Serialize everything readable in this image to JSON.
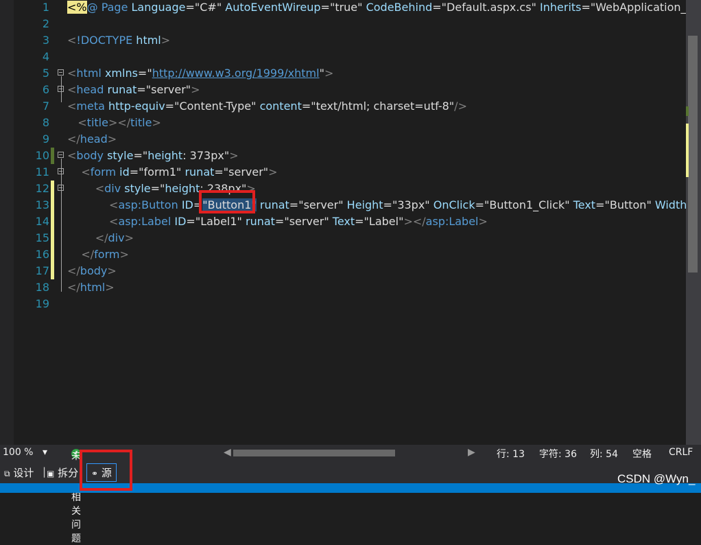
{
  "editor": {
    "line_numbers": [
      "1",
      "2",
      "3",
      "4",
      "5",
      "6",
      "7",
      "8",
      "9",
      "10",
      "11",
      "12",
      "13",
      "14",
      "15",
      "16",
      "17",
      "18",
      "19"
    ],
    "lines": [
      {
        "no": "1",
        "tokens": [
          {
            "c": "dir",
            "t": "<%"
          },
          {
            "c": "k",
            "t": "@ Page "
          },
          {
            "c": "a",
            "t": "Language"
          },
          {
            "c": "p",
            "t": "="
          },
          {
            "c": "p",
            "t": "\"C#\" "
          },
          {
            "c": "a",
            "t": "AutoEventWireup"
          },
          {
            "c": "p",
            "t": "="
          },
          {
            "c": "p",
            "t": "\"true\" "
          },
          {
            "c": "a",
            "t": "CodeBehind"
          },
          {
            "c": "p",
            "t": "="
          },
          {
            "c": "p",
            "t": "\"Default.aspx.cs\" "
          },
          {
            "c": "a",
            "t": "Inherits"
          },
          {
            "c": "p",
            "t": "="
          },
          {
            "c": "p",
            "t": "\"WebApplication_te"
          }
        ]
      },
      {
        "no": "2",
        "tokens": []
      },
      {
        "no": "3",
        "tokens": [
          {
            "c": "t",
            "t": "<"
          },
          {
            "c": "e",
            "t": "!DOCTYPE "
          },
          {
            "c": "a",
            "t": "html"
          },
          {
            "c": "t",
            "t": ">"
          }
        ]
      },
      {
        "no": "4",
        "tokens": []
      },
      {
        "no": "5",
        "tokens": [
          {
            "c": "t",
            "t": "<"
          },
          {
            "c": "e",
            "t": "html "
          },
          {
            "c": "a",
            "t": "xmlns"
          },
          {
            "c": "p",
            "t": "=\""
          },
          {
            "c": "l",
            "t": "http://www.w3.org/1999/xhtml"
          },
          {
            "c": "p",
            "t": "\""
          },
          {
            "c": "t",
            "t": ">"
          }
        ]
      },
      {
        "no": "6",
        "tokens": [
          {
            "c": "t",
            "t": "<"
          },
          {
            "c": "e",
            "t": "head "
          },
          {
            "c": "a",
            "t": "runat"
          },
          {
            "c": "p",
            "t": "=\"server\""
          },
          {
            "c": "t",
            "t": ">"
          }
        ]
      },
      {
        "no": "7",
        "tokens": [
          {
            "c": "t",
            "t": "<"
          },
          {
            "c": "e",
            "t": "meta "
          },
          {
            "c": "a",
            "t": "http-equiv"
          },
          {
            "c": "p",
            "t": "=\"Content-Type\" "
          },
          {
            "c": "a",
            "t": "content"
          },
          {
            "c": "p",
            "t": "=\"text/html; charset=utf-8\""
          },
          {
            "c": "t",
            "t": "/>"
          }
        ]
      },
      {
        "no": "8",
        "tokens": [
          {
            "c": "p",
            "t": "   "
          },
          {
            "c": "t",
            "t": "<"
          },
          {
            "c": "e",
            "t": "title"
          },
          {
            "c": "t",
            "t": "></"
          },
          {
            "c": "e",
            "t": "title"
          },
          {
            "c": "t",
            "t": ">"
          }
        ]
      },
      {
        "no": "9",
        "tokens": [
          {
            "c": "t",
            "t": "</"
          },
          {
            "c": "e",
            "t": "head"
          },
          {
            "c": "t",
            "t": ">"
          }
        ]
      },
      {
        "no": "10",
        "tokens": [
          {
            "c": "t",
            "t": "<"
          },
          {
            "c": "e",
            "t": "body "
          },
          {
            "c": "a",
            "t": "style"
          },
          {
            "c": "p",
            "t": "=\""
          },
          {
            "c": "a",
            "t": "height"
          },
          {
            "c": "p",
            "t": ": 373px\""
          },
          {
            "c": "t",
            "t": ">"
          }
        ]
      },
      {
        "no": "11",
        "tokens": [
          {
            "c": "p",
            "t": "    "
          },
          {
            "c": "t",
            "t": "<"
          },
          {
            "c": "e",
            "t": "form "
          },
          {
            "c": "a",
            "t": "id"
          },
          {
            "c": "p",
            "t": "=\"form1\" "
          },
          {
            "c": "a",
            "t": "runat"
          },
          {
            "c": "p",
            "t": "=\"server\""
          },
          {
            "c": "t",
            "t": ">"
          }
        ]
      },
      {
        "no": "12",
        "tokens": [
          {
            "c": "p",
            "t": "        "
          },
          {
            "c": "t",
            "t": "<"
          },
          {
            "c": "e",
            "t": "div "
          },
          {
            "c": "a",
            "t": "style"
          },
          {
            "c": "p",
            "t": "=\""
          },
          {
            "c": "a",
            "t": "height"
          },
          {
            "c": "p",
            "t": ": 238px\""
          },
          {
            "c": "t",
            "t": ">"
          }
        ]
      },
      {
        "no": "13",
        "tokens": [
          {
            "c": "p",
            "t": "            "
          },
          {
            "c": "t",
            "t": "<"
          },
          {
            "c": "e",
            "t": "asp:Button "
          },
          {
            "c": "a",
            "t": "ID"
          },
          {
            "c": "p",
            "t": "="
          },
          {
            "c": "hl",
            "t": "\"Button1\""
          },
          {
            "c": "p",
            "t": " "
          },
          {
            "c": "a",
            "t": "runat"
          },
          {
            "c": "p",
            "t": "=\"server\" "
          },
          {
            "c": "a",
            "t": "Height"
          },
          {
            "c": "p",
            "t": "=\"33px\" "
          },
          {
            "c": "a",
            "t": "OnClick"
          },
          {
            "c": "p",
            "t": "=\"Button1_Click\" "
          },
          {
            "c": "a",
            "t": "Text"
          },
          {
            "c": "p",
            "t": "=\"Button\" "
          },
          {
            "c": "a",
            "t": "Width"
          },
          {
            "c": "p",
            "t": "="
          }
        ]
      },
      {
        "no": "14",
        "tokens": [
          {
            "c": "p",
            "t": "            "
          },
          {
            "c": "t",
            "t": "<"
          },
          {
            "c": "e",
            "t": "asp:Label "
          },
          {
            "c": "a",
            "t": "ID"
          },
          {
            "c": "p",
            "t": "=\"Label1\" "
          },
          {
            "c": "a",
            "t": "runat"
          },
          {
            "c": "p",
            "t": "=\"server\" "
          },
          {
            "c": "a",
            "t": "Text"
          },
          {
            "c": "p",
            "t": "=\"Label\""
          },
          {
            "c": "t",
            "t": "></"
          },
          {
            "c": "e",
            "t": "asp:Label"
          },
          {
            "c": "t",
            "t": ">"
          }
        ]
      },
      {
        "no": "15",
        "tokens": [
          {
            "c": "p",
            "t": "        "
          },
          {
            "c": "t",
            "t": "</"
          },
          {
            "c": "e",
            "t": "div"
          },
          {
            "c": "t",
            "t": ">"
          }
        ]
      },
      {
        "no": "16",
        "tokens": [
          {
            "c": "p",
            "t": "    "
          },
          {
            "c": "t",
            "t": "</"
          },
          {
            "c": "e",
            "t": "form"
          },
          {
            "c": "t",
            "t": ">"
          }
        ]
      },
      {
        "no": "17",
        "tokens": [
          {
            "c": "t",
            "t": "</"
          },
          {
            "c": "e",
            "t": "body"
          },
          {
            "c": "t",
            "t": ">"
          }
        ]
      },
      {
        "no": "18",
        "tokens": [
          {
            "c": "t",
            "t": "</"
          },
          {
            "c": "e",
            "t": "html"
          },
          {
            "c": "t",
            "t": ">"
          }
        ]
      },
      {
        "no": "19",
        "tokens": []
      }
    ],
    "change_marks": {
      "10": "green",
      "12": "yellow",
      "13": "yellow",
      "14": "yellow",
      "15": "yellow",
      "16": "yellow",
      "17": "yellow"
    }
  },
  "status": {
    "zoom": "100 %",
    "zoom_dropdown": "▾",
    "issues_icon": "check-icon",
    "issues": "未找到相关问题",
    "row": "行: 13",
    "char": "字符: 36",
    "col": "列: 54",
    "whitespace": "空格",
    "line_ending": "CRLF"
  },
  "view_tabs": {
    "design": "设计",
    "split": "拆分",
    "source": "源"
  },
  "watermark": "CSDN @Wyn_",
  "colors": {
    "background": "#1e1e1e",
    "line_number": "#2b91af",
    "element": "#569cd6",
    "attribute": "#9cdcfe",
    "punctuation": "#808080",
    "status_bar": "#2d2d30",
    "accent_bar": "#007acc",
    "annotation_box": "#e02020"
  }
}
